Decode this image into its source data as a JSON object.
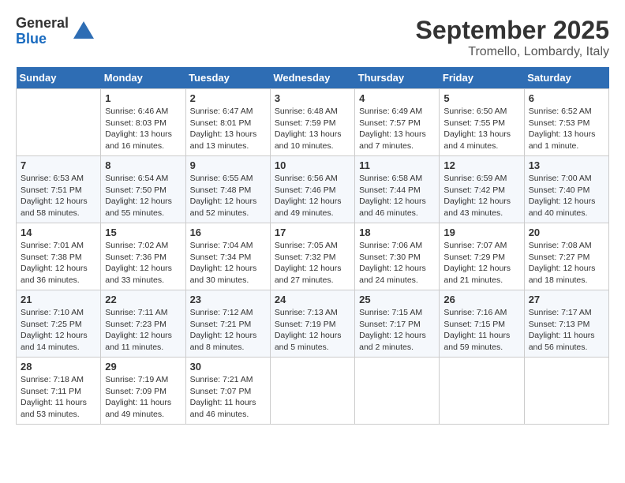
{
  "header": {
    "logo_general": "General",
    "logo_blue": "Blue",
    "month_title": "September 2025",
    "location": "Tromello, Lombardy, Italy"
  },
  "days_of_week": [
    "Sunday",
    "Monday",
    "Tuesday",
    "Wednesday",
    "Thursday",
    "Friday",
    "Saturday"
  ],
  "weeks": [
    [
      {
        "day": "",
        "sunrise": "",
        "sunset": "",
        "daylight": ""
      },
      {
        "day": "1",
        "sunrise": "Sunrise: 6:46 AM",
        "sunset": "Sunset: 8:03 PM",
        "daylight": "Daylight: 13 hours and 16 minutes."
      },
      {
        "day": "2",
        "sunrise": "Sunrise: 6:47 AM",
        "sunset": "Sunset: 8:01 PM",
        "daylight": "Daylight: 13 hours and 13 minutes."
      },
      {
        "day": "3",
        "sunrise": "Sunrise: 6:48 AM",
        "sunset": "Sunset: 7:59 PM",
        "daylight": "Daylight: 13 hours and 10 minutes."
      },
      {
        "day": "4",
        "sunrise": "Sunrise: 6:49 AM",
        "sunset": "Sunset: 7:57 PM",
        "daylight": "Daylight: 13 hours and 7 minutes."
      },
      {
        "day": "5",
        "sunrise": "Sunrise: 6:50 AM",
        "sunset": "Sunset: 7:55 PM",
        "daylight": "Daylight: 13 hours and 4 minutes."
      },
      {
        "day": "6",
        "sunrise": "Sunrise: 6:52 AM",
        "sunset": "Sunset: 7:53 PM",
        "daylight": "Daylight: 13 hours and 1 minute."
      }
    ],
    [
      {
        "day": "7",
        "sunrise": "Sunrise: 6:53 AM",
        "sunset": "Sunset: 7:51 PM",
        "daylight": "Daylight: 12 hours and 58 minutes."
      },
      {
        "day": "8",
        "sunrise": "Sunrise: 6:54 AM",
        "sunset": "Sunset: 7:50 PM",
        "daylight": "Daylight: 12 hours and 55 minutes."
      },
      {
        "day": "9",
        "sunrise": "Sunrise: 6:55 AM",
        "sunset": "Sunset: 7:48 PM",
        "daylight": "Daylight: 12 hours and 52 minutes."
      },
      {
        "day": "10",
        "sunrise": "Sunrise: 6:56 AM",
        "sunset": "Sunset: 7:46 PM",
        "daylight": "Daylight: 12 hours and 49 minutes."
      },
      {
        "day": "11",
        "sunrise": "Sunrise: 6:58 AM",
        "sunset": "Sunset: 7:44 PM",
        "daylight": "Daylight: 12 hours and 46 minutes."
      },
      {
        "day": "12",
        "sunrise": "Sunrise: 6:59 AM",
        "sunset": "Sunset: 7:42 PM",
        "daylight": "Daylight: 12 hours and 43 minutes."
      },
      {
        "day": "13",
        "sunrise": "Sunrise: 7:00 AM",
        "sunset": "Sunset: 7:40 PM",
        "daylight": "Daylight: 12 hours and 40 minutes."
      }
    ],
    [
      {
        "day": "14",
        "sunrise": "Sunrise: 7:01 AM",
        "sunset": "Sunset: 7:38 PM",
        "daylight": "Daylight: 12 hours and 36 minutes."
      },
      {
        "day": "15",
        "sunrise": "Sunrise: 7:02 AM",
        "sunset": "Sunset: 7:36 PM",
        "daylight": "Daylight: 12 hours and 33 minutes."
      },
      {
        "day": "16",
        "sunrise": "Sunrise: 7:04 AM",
        "sunset": "Sunset: 7:34 PM",
        "daylight": "Daylight: 12 hours and 30 minutes."
      },
      {
        "day": "17",
        "sunrise": "Sunrise: 7:05 AM",
        "sunset": "Sunset: 7:32 PM",
        "daylight": "Daylight: 12 hours and 27 minutes."
      },
      {
        "day": "18",
        "sunrise": "Sunrise: 7:06 AM",
        "sunset": "Sunset: 7:30 PM",
        "daylight": "Daylight: 12 hours and 24 minutes."
      },
      {
        "day": "19",
        "sunrise": "Sunrise: 7:07 AM",
        "sunset": "Sunset: 7:29 PM",
        "daylight": "Daylight: 12 hours and 21 minutes."
      },
      {
        "day": "20",
        "sunrise": "Sunrise: 7:08 AM",
        "sunset": "Sunset: 7:27 PM",
        "daylight": "Daylight: 12 hours and 18 minutes."
      }
    ],
    [
      {
        "day": "21",
        "sunrise": "Sunrise: 7:10 AM",
        "sunset": "Sunset: 7:25 PM",
        "daylight": "Daylight: 12 hours and 14 minutes."
      },
      {
        "day": "22",
        "sunrise": "Sunrise: 7:11 AM",
        "sunset": "Sunset: 7:23 PM",
        "daylight": "Daylight: 12 hours and 11 minutes."
      },
      {
        "day": "23",
        "sunrise": "Sunrise: 7:12 AM",
        "sunset": "Sunset: 7:21 PM",
        "daylight": "Daylight: 12 hours and 8 minutes."
      },
      {
        "day": "24",
        "sunrise": "Sunrise: 7:13 AM",
        "sunset": "Sunset: 7:19 PM",
        "daylight": "Daylight: 12 hours and 5 minutes."
      },
      {
        "day": "25",
        "sunrise": "Sunrise: 7:15 AM",
        "sunset": "Sunset: 7:17 PM",
        "daylight": "Daylight: 12 hours and 2 minutes."
      },
      {
        "day": "26",
        "sunrise": "Sunrise: 7:16 AM",
        "sunset": "Sunset: 7:15 PM",
        "daylight": "Daylight: 11 hours and 59 minutes."
      },
      {
        "day": "27",
        "sunrise": "Sunrise: 7:17 AM",
        "sunset": "Sunset: 7:13 PM",
        "daylight": "Daylight: 11 hours and 56 minutes."
      }
    ],
    [
      {
        "day": "28",
        "sunrise": "Sunrise: 7:18 AM",
        "sunset": "Sunset: 7:11 PM",
        "daylight": "Daylight: 11 hours and 53 minutes."
      },
      {
        "day": "29",
        "sunrise": "Sunrise: 7:19 AM",
        "sunset": "Sunset: 7:09 PM",
        "daylight": "Daylight: 11 hours and 49 minutes."
      },
      {
        "day": "30",
        "sunrise": "Sunrise: 7:21 AM",
        "sunset": "Sunset: 7:07 PM",
        "daylight": "Daylight: 11 hours and 46 minutes."
      },
      {
        "day": "",
        "sunrise": "",
        "sunset": "",
        "daylight": ""
      },
      {
        "day": "",
        "sunrise": "",
        "sunset": "",
        "daylight": ""
      },
      {
        "day": "",
        "sunrise": "",
        "sunset": "",
        "daylight": ""
      },
      {
        "day": "",
        "sunrise": "",
        "sunset": "",
        "daylight": ""
      }
    ]
  ]
}
